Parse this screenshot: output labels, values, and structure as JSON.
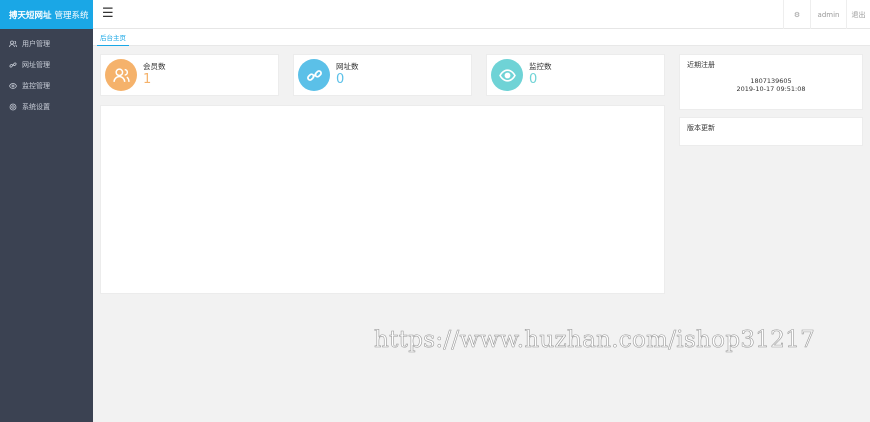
{
  "brand": {
    "name_bold": "搏天短网址",
    "name_rest": "管理系统"
  },
  "sidebar": {
    "items": [
      {
        "label": "用户管理",
        "icon": "users-icon"
      },
      {
        "label": "网址管理",
        "icon": "link-icon"
      },
      {
        "label": "监控管理",
        "icon": "eye-icon"
      },
      {
        "label": "系统设置",
        "icon": "gear-icon"
      }
    ]
  },
  "header": {
    "menu_icon": "☰",
    "user": "admin",
    "logout": "退出",
    "settings_icon": "⚙"
  },
  "tabs": [
    {
      "label": "后台主页"
    }
  ],
  "stats": [
    {
      "label": "会员数",
      "value": "1",
      "color": "#f5b26b",
      "icon": "users-icon"
    },
    {
      "label": "网址数",
      "value": "0",
      "color": "#5bc0e8",
      "icon": "link-icon"
    },
    {
      "label": "监控数",
      "value": "0",
      "color": "#6fd3d6",
      "icon": "eye-icon"
    }
  ],
  "recent_registration": {
    "title": "近期注册",
    "user_id": "1807139605",
    "time": "2019-10-17 09:51:08"
  },
  "version_update": {
    "title": "版本更新"
  },
  "watermark": "https://www.huzhan.com/ishop31217"
}
